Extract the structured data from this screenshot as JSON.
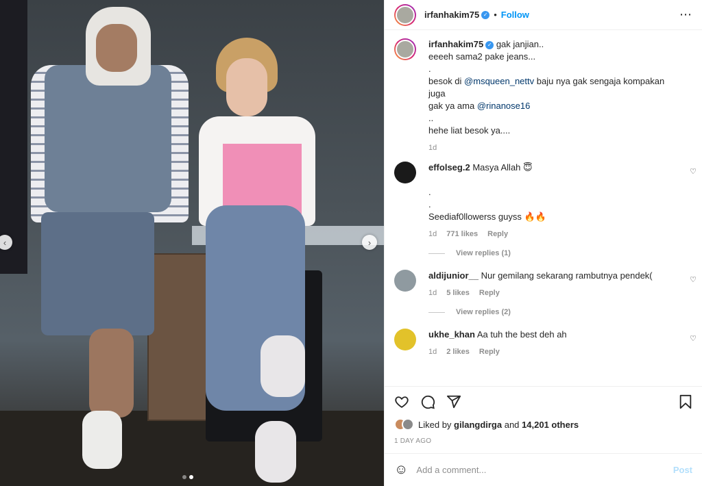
{
  "post": {
    "username": "irfanhakim75",
    "verified_glyph": "✓",
    "separator": "•",
    "follow_label": "Follow",
    "more_icon": "more-horizontal-icon",
    "more_glyph": "⋯"
  },
  "media": {
    "slide_count": 2,
    "active_slide": 2,
    "prev_glyph": "‹",
    "next_glyph": "›"
  },
  "caption": {
    "username": "irfanhakim75",
    "lines": [
      {
        "pre": "gak janjian..",
        "mention": "",
        "post": ""
      },
      {
        "pre": "eeeeh sama2 pake jeans...",
        "mention": "",
        "post": ""
      },
      {
        "pre": ".",
        "mention": "",
        "post": ""
      },
      {
        "pre": "besok di ",
        "mention": "@msqueen_nettv",
        "post": " baju nya gak sengaja kompakan juga"
      },
      {
        "pre": "gak ya ama ",
        "mention": "@rinanose16",
        "post": ""
      },
      {
        "pre": "..",
        "mention": "",
        "post": ""
      },
      {
        "pre": "hehe liat besok ya....",
        "mention": "",
        "post": ""
      }
    ],
    "time": "1d"
  },
  "comments": [
    {
      "username": "effolseg.2",
      "lines": [
        "Masya Allah 😇",
        "",
        ".",
        ".",
        "Seediaf0llowerss guyss 🔥🔥"
      ],
      "time": "1d",
      "likes": "771 likes",
      "reply": "Reply",
      "view_replies": "View replies (1)"
    },
    {
      "username": "aldijunior__",
      "lines": [
        "Nur gemilang sekarang rambutnya pendek("
      ],
      "time": "1d",
      "likes": "5 likes",
      "reply": "Reply",
      "view_replies": "View replies (2)"
    },
    {
      "username": "ukhe_khan",
      "lines": [
        "Aa tuh the best deh ah"
      ],
      "time": "1d",
      "likes": "2 likes",
      "reply": "Reply",
      "view_replies": ""
    }
  ],
  "actions": {
    "liked_prefix": "Liked by ",
    "liked_user": "gilangdirga",
    "liked_mid": " and ",
    "liked_count": "14,201 others",
    "time_ago": "1 DAY AGO"
  },
  "add_comment": {
    "placeholder": "Add a comment...",
    "post_label": "Post",
    "emoji_glyph": "☺"
  },
  "colors": {
    "accent": "#0095f6",
    "verified": "#3897f0",
    "mention": "#00376b",
    "muted": "#8e8e8e",
    "post_disabled": "#b2dffc"
  }
}
